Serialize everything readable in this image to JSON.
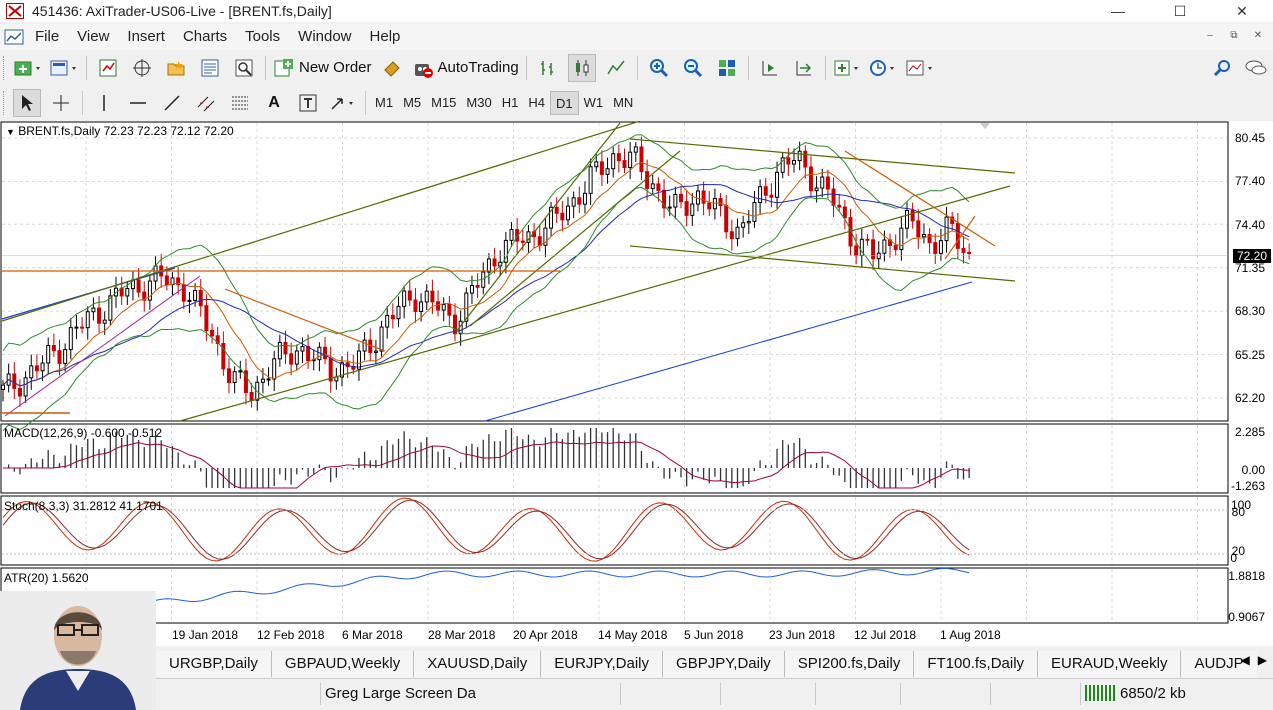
{
  "window": {
    "title": "451436: AxiTrader-US06-Live - [BRENT.fs,Daily]",
    "minimize": "—",
    "maximize": "☐",
    "close": "✕"
  },
  "menu": {
    "items": [
      "File",
      "View",
      "Insert",
      "Charts",
      "Tools",
      "Window",
      "Help"
    ]
  },
  "toolbar": {
    "new_order": "New Order",
    "auto_trading": "AutoTrading"
  },
  "timeframes": [
    "M1",
    "M5",
    "M15",
    "M30",
    "H1",
    "H4",
    "D1",
    "W1",
    "MN"
  ],
  "active_timeframe": "D1",
  "chart": {
    "main_label": "BRENT.fs,Daily  72.23 72.23 72.12 72.20",
    "current_price": "72.20",
    "price_ticks": [
      "80.45",
      "77.40",
      "74.40",
      "71.35",
      "68.30",
      "65.25",
      "62.20"
    ],
    "macd_label": "MACD(12,26,9) -0.600 -0.512",
    "macd_ticks": [
      "2.285",
      "0.00",
      "-1.263"
    ],
    "stoch_label": "Stoch(8,3,3) 31.2812 41.1701",
    "stoch_ticks": [
      "100",
      "80",
      "20",
      "0"
    ],
    "atr_label": "ATR(20) 1.5620",
    "atr_ticks": [
      "1.8818",
      "0.9067"
    ],
    "date_ticks": [
      "19 Jan 2018",
      "12 Feb 2018",
      "6 Mar 2018",
      "28 Mar 2018",
      "20 Apr 2018",
      "14 May 2018",
      "5 Jun 2018",
      "23 Jun 2018",
      "12 Jul 2018",
      "1 Aug 2018"
    ],
    "colors": {
      "bull": "#000000",
      "bear": "#cc0000",
      "ma_long": "#1e3cdc",
      "bollinger": "#2e8b2e",
      "channel": "#556b00",
      "resistance": "#d05a00"
    }
  },
  "chart_data": {
    "type": "candlestick",
    "title": "BRENT.fs,Daily",
    "ylim": [
      60.5,
      81.5
    ],
    "x": [
      "19 Jan 2018",
      "12 Feb 2018",
      "6 Mar 2018",
      "28 Mar 2018",
      "20 Apr 2018",
      "14 May 2018",
      "5 Jun 2018",
      "23 Jun 2018",
      "12 Jul 2018",
      "1 Aug 2018"
    ],
    "close_approx": [
      69.8,
      63.0,
      64.6,
      69.5,
      74.0,
      79.2,
      75.5,
      77.8,
      73.0,
      72.2
    ]
  },
  "tabs": [
    "URGBP,Daily",
    "GBPAUD,Weekly",
    "XAUUSD,Daily",
    "EURJPY,Daily",
    "GBPJPY,Daily",
    "SPI200.fs,Daily",
    "FT100.fs,Daily",
    "EURAUD,Weekly",
    "AUDJP"
  ],
  "status": {
    "profile": "Greg Large Screen Da",
    "traffic": "6850/2 kb"
  }
}
